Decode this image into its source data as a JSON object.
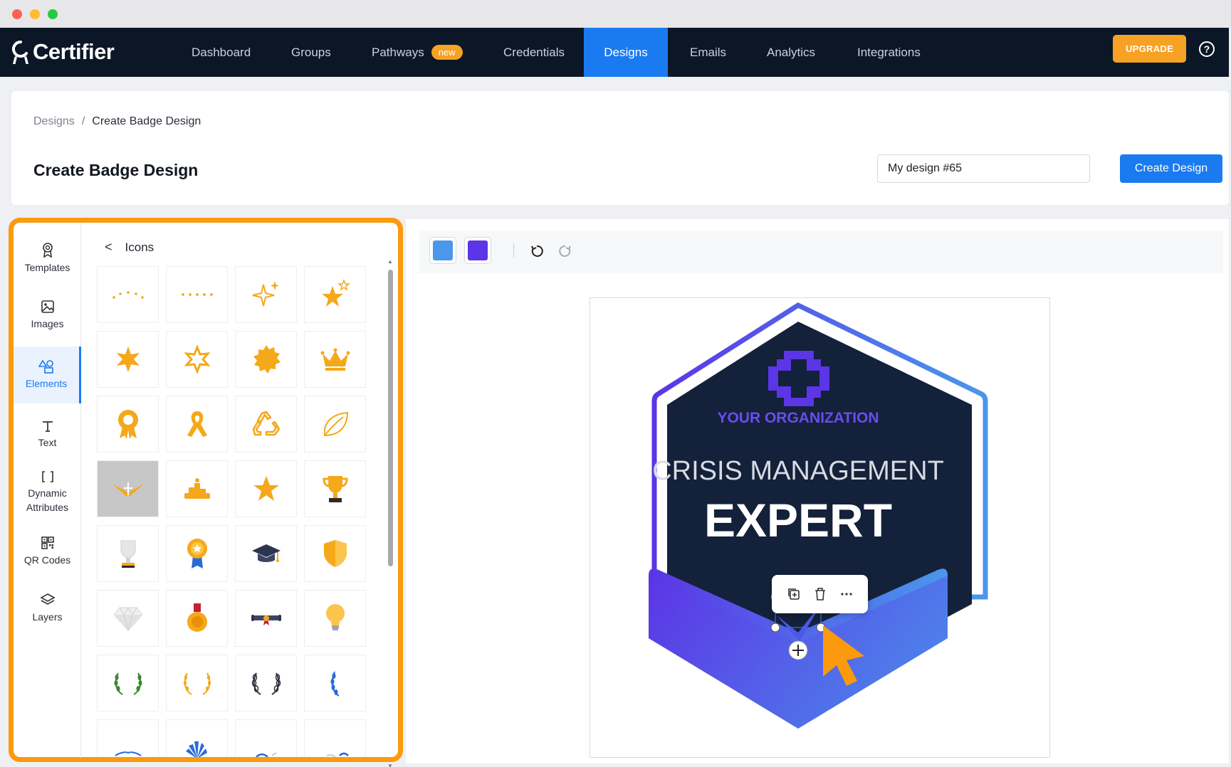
{
  "app": {
    "brand": "Certifier"
  },
  "nav": {
    "items": [
      {
        "label": "Dashboard"
      },
      {
        "label": "Groups"
      },
      {
        "label": "Pathways",
        "badge": "new"
      },
      {
        "label": "Credentials"
      },
      {
        "label": "Designs",
        "active": true
      },
      {
        "label": "Emails"
      },
      {
        "label": "Analytics"
      },
      {
        "label": "Integrations"
      }
    ],
    "upgrade_label": "UPGRADE",
    "help_icon": "?"
  },
  "header": {
    "breadcrumb": {
      "parent": "Designs",
      "separator": "/",
      "current": "Create Badge Design"
    },
    "title": "Create Badge Design",
    "design_name_value": "My design #65",
    "create_label": "Create Design"
  },
  "sidebar": {
    "items": [
      {
        "label": "Templates",
        "icon": "award-icon"
      },
      {
        "label": "Images",
        "icon": "image-icon"
      },
      {
        "label": "Elements",
        "icon": "shapes-icon",
        "active": true
      },
      {
        "label": "Text",
        "icon": "text-icon"
      },
      {
        "label": "Dynamic\nAttributes",
        "icon": "brackets-icon"
      },
      {
        "label": "QR Codes",
        "icon": "qr-icon"
      },
      {
        "label": "Layers",
        "icon": "layers-icon"
      }
    ]
  },
  "elements_panel": {
    "back_icon": "<",
    "title": "Icons",
    "icons": [
      "dots-arc-icon",
      "dots-line-icon",
      "sparkle-icon",
      "star-sparkle-icon",
      "star-6-icon",
      "star-6-outline-icon",
      "seal-icon",
      "crown-icon",
      "rosette-icon",
      "ribbon-icon",
      "recycle-icon",
      "leaf-icon",
      "wings-icon",
      "podium-icon",
      "star-icon",
      "trophy-icon",
      "silver-trophy-icon",
      "medal-ribbon-icon",
      "graduation-cap-icon",
      "shield-icon",
      "diamond-icon",
      "gold-medal-icon",
      "diploma-scroll-icon",
      "lightbulb-icon",
      "laurel-green-icon",
      "laurel-gold-icon",
      "laurel-dark-icon",
      "laurel-blue-icon"
    ],
    "selected_index": 12
  },
  "toolbar": {
    "colors": [
      "#4a97ec",
      "#5b35e6"
    ],
    "undo_icon": "undo-icon",
    "redo_icon": "redo-icon"
  },
  "badge": {
    "organization": "YOUR ORGANIZATION",
    "line1": "CRISIS MANAGEMENT",
    "line2": "EXPERT",
    "colors": {
      "dark": "#13213a",
      "purple": "#5b35e6",
      "blue": "#4a97ec",
      "accent": "#fb9a0d"
    }
  },
  "floating_toolbar": {
    "icons": [
      "duplicate-icon",
      "trash-icon",
      "more-icon"
    ]
  }
}
